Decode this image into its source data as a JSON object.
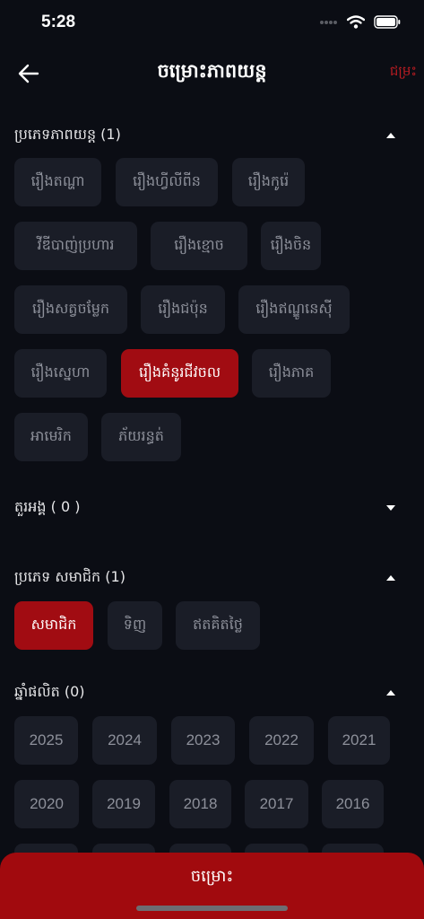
{
  "status": {
    "time": "5:28"
  },
  "header": {
    "title": "ចម្រោះភាពយន្ត",
    "reset_label": "ជម្រះ"
  },
  "sections": {
    "genre": {
      "title": "ប្រភេទភាពយន្ត (1)",
      "chips": [
        "រឿងតណ្ហា",
        "រឿងហ្វីលីពីន",
        "រឿងកូរ៉េ",
        "វីឌីបាញ់ប្រហារ",
        "រឿងខ្មោច",
        "រឿងចិន",
        "រឿងសត្វចម្លែក",
        "រឿងជប៉ុន",
        "រឿងឥណ្ឌូនេស៊ី",
        "រឿងស្នេហា",
        "រឿងគំនូរជីវចល",
        "រឿងភាគ",
        "អាមេរិក",
        "ភ័យរន្ធត់"
      ],
      "selected": "រឿងគំនូរជីវចល"
    },
    "actors": {
      "title": "តួរអង្គ ( 0 )"
    },
    "membership": {
      "title": "ប្រភេទ សមាជិក (1)",
      "chips": [
        "សមាជិក",
        "ទិញ",
        "ឥតគិតថ្លៃ"
      ],
      "selected": "សមាជិក"
    },
    "year": {
      "title": "ឆ្នាំផលិត (0)",
      "chips": [
        "2025",
        "2024",
        "2023",
        "2022",
        "2021",
        "2020",
        "2019",
        "2018",
        "2017",
        "2016"
      ]
    }
  },
  "footer": {
    "apply_label": "ចម្រោះ"
  },
  "colors": {
    "accent": "#a10c12",
    "background": "#0b0d14",
    "chip": "#1a1d27",
    "reset": "#b81c22"
  }
}
